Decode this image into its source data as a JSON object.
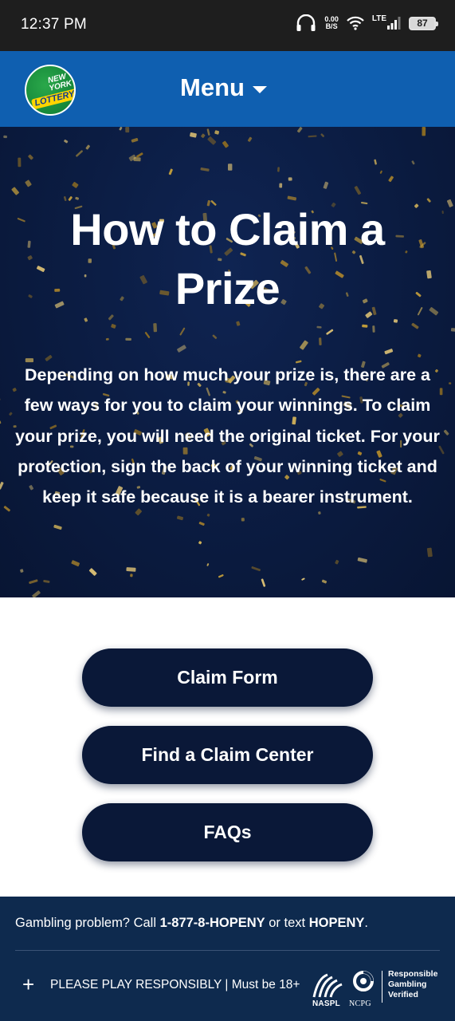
{
  "status_bar": {
    "time": "12:37 PM",
    "net_speed_value": "0.00",
    "net_speed_unit": "B/S",
    "network": "LTE",
    "battery": "87"
  },
  "header": {
    "logo": {
      "line1": "NEW",
      "line2": "YORK",
      "line3": "LOTTERY"
    },
    "menu_label": "Menu"
  },
  "hero": {
    "title": "How to Claim a Prize",
    "description": "Depending on how much your prize is, there are a few ways for you to claim your winnings. To claim your prize, you will need the original ticket. For your protection, sign the back of your winning ticket and keep it safe because it is a bearer instrument."
  },
  "buttons": {
    "claim_form": "Claim Form",
    "find_claim_center": "Find a Claim Center",
    "faqs": "FAQs"
  },
  "footer": {
    "gambling_prefix": "Gambling problem? Call ",
    "hotline": "1-877-8-HOPENY",
    "gambling_middle": " or text ",
    "text_code": "HOPENY",
    "gambling_suffix": ".",
    "play_responsibly": "PLAY RESPONSIBLY | Must be 18+",
    "play_prefix": "PLEASE ",
    "naspl_label": "NASPL",
    "ncpg_label": "NCPG",
    "responsible_line1": "Responsible",
    "responsible_line2": "Gambling",
    "responsible_line3": "Verified"
  },
  "colors": {
    "header_blue": "#0f5fb0",
    "hero_navy": "#0b1c42",
    "button_navy": "#0a1838",
    "footer_navy": "#0e2a4e",
    "confetti_gold": "#c9a23a"
  },
  "icons": [
    "headphone-icon",
    "wifi-icon",
    "signal-icon",
    "battery-icon",
    "chevron-down-icon",
    "plus-icon",
    "naspl-logo",
    "ncpg-logo"
  ]
}
